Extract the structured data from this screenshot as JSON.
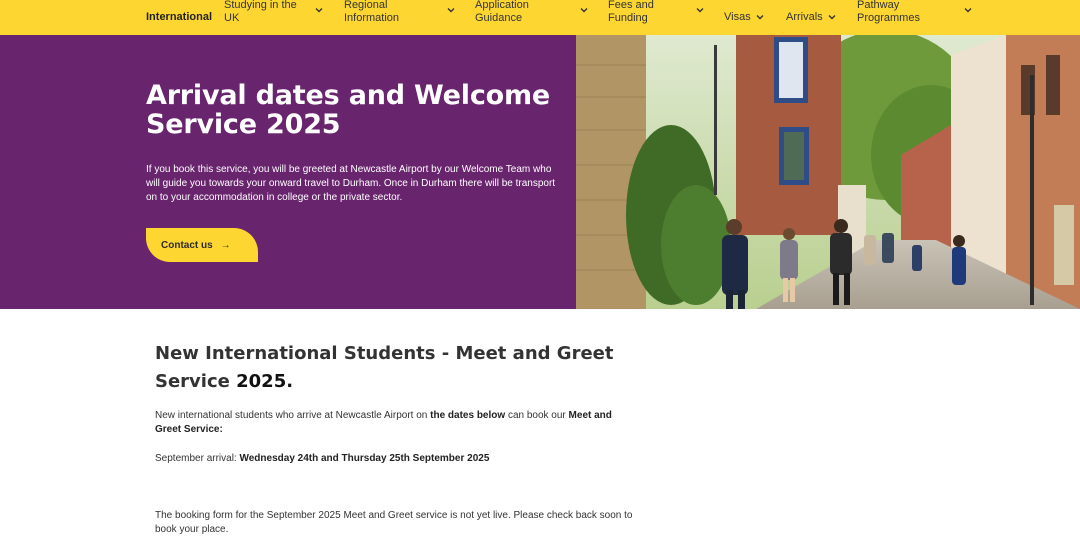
{
  "nav": {
    "items": [
      {
        "label": "International",
        "active": true,
        "dropdown": false
      },
      {
        "label": "Studying in the UK",
        "dropdown": true
      },
      {
        "label": "Regional Information",
        "dropdown": true
      },
      {
        "label": "Application Guidance",
        "dropdown": true
      },
      {
        "label": "Fees and Funding",
        "dropdown": true
      },
      {
        "label": "Visas",
        "dropdown": true
      },
      {
        "label": "Arrivals",
        "dropdown": true
      },
      {
        "label": "Pathway Programmes",
        "dropdown": true
      }
    ]
  },
  "hero": {
    "title": "Arrival dates and Welcome Service 2025",
    "description": "If you book this service, you will be greeted at Newcastle Airport by our Welcome Team who will guide you towards your onward travel to Durham. Once in Durham there will be transport on to your accommodation in college or the private sector.",
    "button_label": "Contact us",
    "button_arrow": "→",
    "image_alt": "Students walking along a cobbled street in Durham"
  },
  "content": {
    "heading_main": "New International Students - Meet and Greet Service",
    "heading_year": "2025.",
    "intro_1": "New international students who arrive at Newcastle Airport on",
    "intro_bold_1": "the dates below",
    "intro_2": "can book our",
    "intro_bold_2": "Meet and Greet Service:",
    "arrival_label": "September arrival:",
    "arrival_dates": "Wednesday 24th and Thursday 25th September 2025",
    "booking_note": "The booking form for the September 2025 Meet and Greet service is not yet live. Please check back soon to book your place."
  },
  "colors": {
    "nav_bg": "#fdd631",
    "hero_bg": "#68246d",
    "button_bg": "#fdd631",
    "text": "#333333"
  }
}
